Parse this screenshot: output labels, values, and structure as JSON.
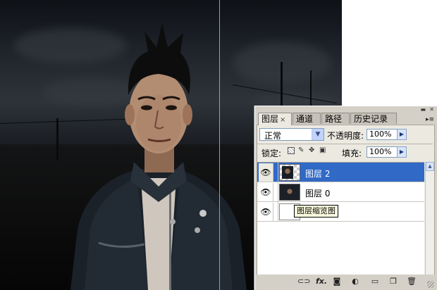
{
  "panel": {
    "tabs": [
      {
        "label": "图层",
        "close": "×",
        "active": true
      },
      {
        "label": "通道",
        "active": false
      },
      {
        "label": "路径",
        "active": false
      },
      {
        "label": "历史记录",
        "active": false
      }
    ],
    "menu_icon": "menu-arrow-icon",
    "blend_mode": "正常",
    "opacity_label": "不透明度:",
    "opacity_value": "100%",
    "lock_label": "锁定:",
    "fill_label": "填充:",
    "fill_value": "100%",
    "layers": [
      {
        "name": "图层 2",
        "selected": true,
        "thumbnail": "photo-with-transparency"
      },
      {
        "name": "图层 0",
        "selected": false,
        "thumbnail": "photo"
      },
      {
        "name": "",
        "selected": false,
        "thumbnail": "white"
      }
    ],
    "tooltip": "图层缩览图",
    "bottom_icons": [
      "link-icon",
      "fx-icon",
      "mask-icon",
      "adjustment-icon",
      "folder-icon",
      "new-layer-icon",
      "trash-icon"
    ],
    "bottom_labels": {
      "fx": "fx."
    }
  },
  "colors": {
    "selection": "#3169c6",
    "guide": "#1ed4d4",
    "panel_bg": "#d4d0c8"
  }
}
